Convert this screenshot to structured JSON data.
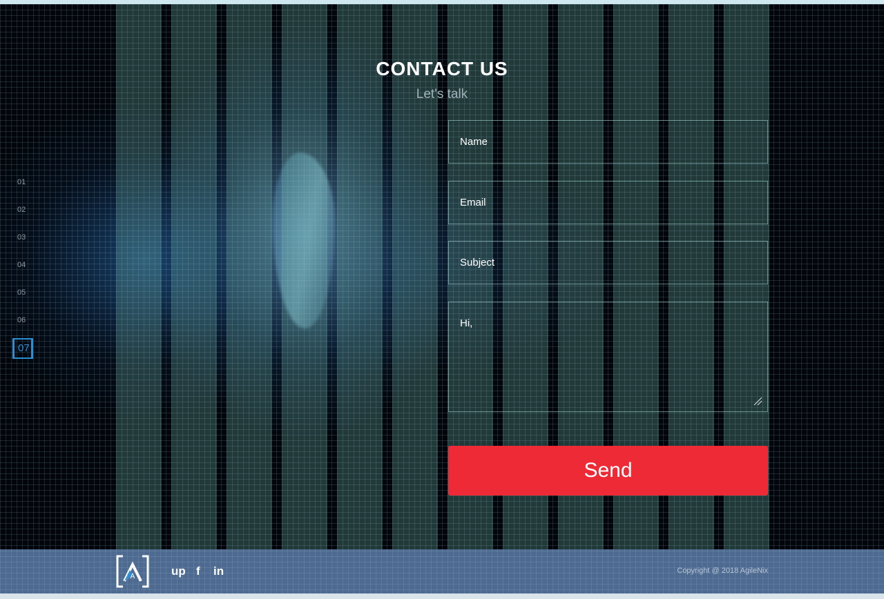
{
  "side_nav": {
    "items": [
      {
        "label": "01"
      },
      {
        "label": "02"
      },
      {
        "label": "03"
      },
      {
        "label": "04"
      },
      {
        "label": "05"
      },
      {
        "label": "06"
      },
      {
        "label": "07",
        "active": true
      }
    ]
  },
  "header": {
    "title": "CONTACT US",
    "subtitle": "Let's talk"
  },
  "form": {
    "name_placeholder": "Name",
    "email_placeholder": "Email",
    "subject_placeholder": "Subject",
    "message_value": "Hi,",
    "send_label": "Send"
  },
  "footer": {
    "logo_letter": "A",
    "social": [
      {
        "label": "up",
        "icon": "upwork-icon"
      },
      {
        "label": "f",
        "icon": "facebook-icon"
      },
      {
        "label": "in",
        "icon": "linkedin-icon"
      }
    ],
    "copyright": "Copyright @ 2018 AgileNix"
  },
  "colors": {
    "accent_red": "#ee2a36",
    "nav_active_blue": "#2b8fd6",
    "footer_bg": "#4f6a90"
  }
}
